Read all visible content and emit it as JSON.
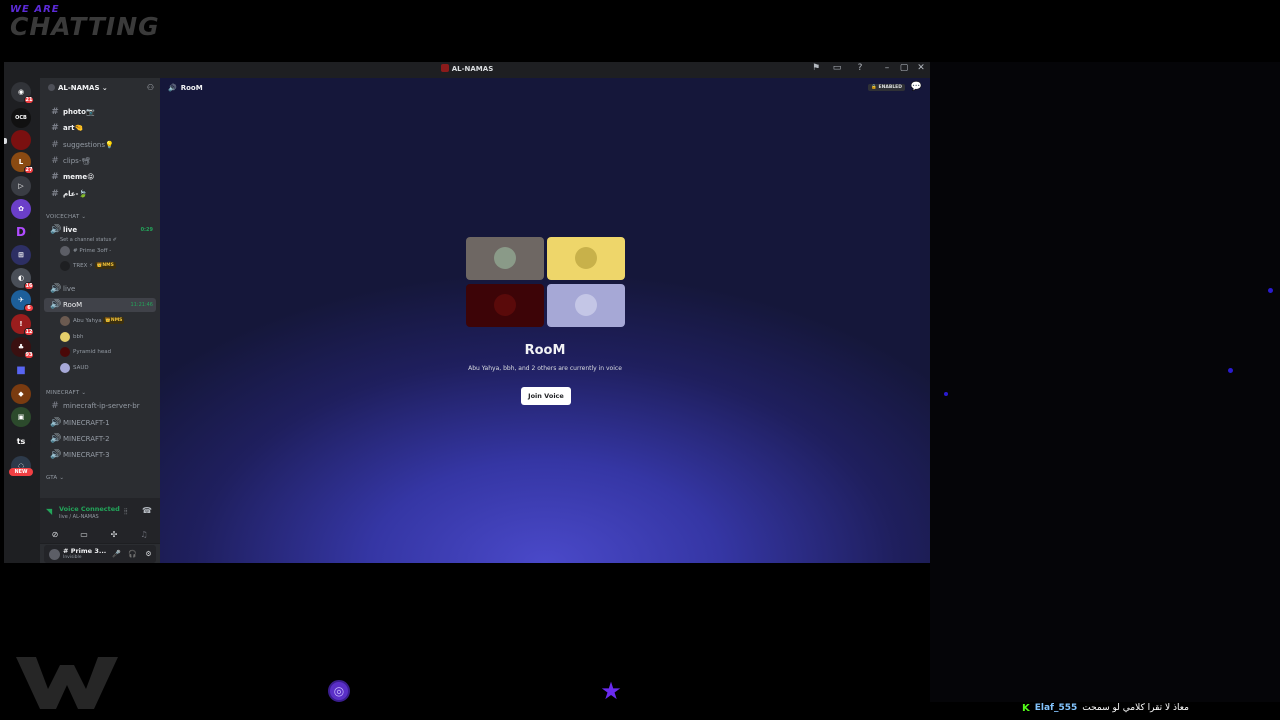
{
  "overlay": {
    "logo_small": "WE ARE",
    "logo_big": "CHATTING",
    "chat_user": "Elaf_555",
    "chat_message": "معاذ لا تقرا كلامي لو سمحت"
  },
  "window": {
    "title": "AL-NAMAS",
    "controls": [
      "⚑",
      "▭",
      "?",
      "–",
      "▢",
      "✕"
    ]
  },
  "rail": {
    "badges": [
      "21",
      "27",
      "16",
      "6",
      "12",
      "93"
    ],
    "labels": [
      "OCB",
      "ts",
      "NEW"
    ]
  },
  "guild": {
    "name": "AL-NAMAS",
    "chevron": "⌄"
  },
  "channels": [
    {
      "name": "photo📷",
      "bold": true
    },
    {
      "name": "art🤏",
      "bold": true
    },
    {
      "name": "suggestions💡",
      "bold": false
    },
    {
      "name": "clips-📽",
      "bold": false
    },
    {
      "name": "meme😝",
      "bold": true
    },
    {
      "name": "عام-🍃",
      "bold": true
    }
  ],
  "voicechat": {
    "category": "VOICECHAT",
    "live": {
      "name": "live",
      "timer": "0:29",
      "status": "Set a channel status ✐"
    },
    "live_users": [
      {
        "name": "# Prime 3off -",
        "tag": ""
      },
      {
        "name": "TREX ⚡",
        "tag": "👑NMS"
      }
    ],
    "live2": "live",
    "room": {
      "name": "RooM",
      "timer": "11:21:46"
    },
    "room_users": [
      {
        "name": "Abu Yahya",
        "tag": "👑NMS"
      },
      {
        "name": "bbh",
        "tag": ""
      },
      {
        "name": "Pyramid head",
        "tag": ""
      },
      {
        "name": "SAUD",
        "tag": ""
      }
    ]
  },
  "minecraft": {
    "category": "MINECRAFT",
    "channels": [
      "minecraft-ip-server-br",
      "MINECRAFT-1",
      "MINECRAFT-2",
      "MINECRAFT-3"
    ]
  },
  "gta": {
    "category": "GTA"
  },
  "voice_panel": {
    "status": "Voice Connected",
    "channel": "live / AL-NAMAS"
  },
  "user_panel": {
    "name": "# Prime 3...",
    "status": "Invisible"
  },
  "main": {
    "channel": "RooM",
    "enabled_label": "🔒 ENABLED",
    "title": "RooM",
    "subtitle": "Abu Yahya, bbh, and 2 others are currently in voice",
    "join_label": "Join Voice"
  }
}
